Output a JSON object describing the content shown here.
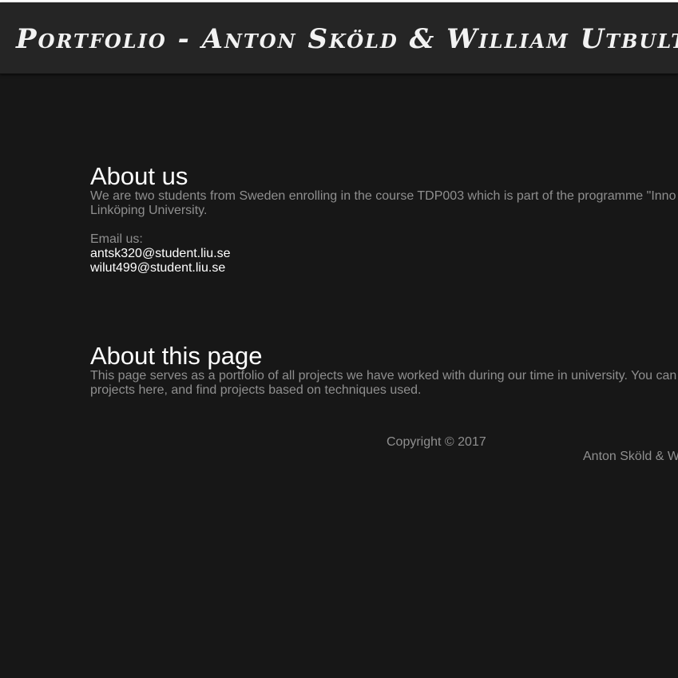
{
  "header": {
    "title": "Portfolio - Anton Sköld & William Utbult"
  },
  "about_us": {
    "heading": "About us",
    "description_line1": "We are two students from Sweden enrolling in the course TDP003 which is part of the programme \"Inno",
    "description_line2": "Linköping University.",
    "email_label": "Email us:",
    "emails": [
      "antsk320@student.liu.se",
      "wilut499@student.liu.se"
    ]
  },
  "about_page": {
    "heading": "About this page",
    "description_line1": "This page serves as a portfolio of all projects we have worked with during our time in university. You can",
    "description_line2": "projects here, and find projects based on techniques used."
  },
  "footer": {
    "copyright": "Copyright © 2017",
    "names": "Anton Sköld & W"
  }
}
